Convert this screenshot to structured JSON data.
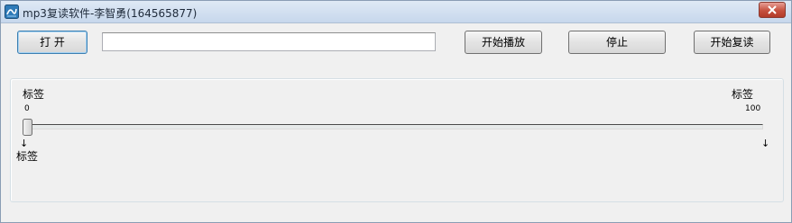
{
  "window": {
    "title": "mp3复读软件-李智勇(164565877)",
    "icon": "app-icon",
    "close_icon": "close-icon"
  },
  "toolbar": {
    "open_label": "打  开",
    "path_value": "",
    "play_label": "开始播放",
    "stop_label": "停止",
    "repeat_label": "开始复读"
  },
  "slider": {
    "label_left_top": "标签",
    "label_right_top": "标签",
    "min_label": "0",
    "max_label": "100",
    "value": 0,
    "marker_start_label": "标签",
    "marker_start_arrow": "↓",
    "marker_end_arrow": "↓"
  }
}
